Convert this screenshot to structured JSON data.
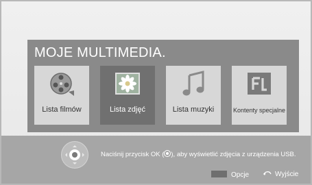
{
  "panel": {
    "title": "MOJE MULTIMEDIA."
  },
  "tiles": [
    {
      "label": "Lista filmów",
      "icon": "film-reel-icon",
      "selected": false
    },
    {
      "label": "Lista zdjęć",
      "icon": "photo-flower-icon",
      "selected": true
    },
    {
      "label": "Lista muzyki",
      "icon": "music-note-icon",
      "selected": false
    },
    {
      "label": "Kontenty specjalne",
      "icon": "fl-logo-icon",
      "selected": false
    }
  ],
  "hint": {
    "before": "Naciśnij przycisk OK (",
    "after": "), aby wyświetlić zdjęcia z urządzenia USB."
  },
  "footer": {
    "options_label": "Opcje",
    "exit_label": "Wyjście"
  },
  "colors": {
    "panel": "#8a8a8a",
    "tile": "#d7d7d7",
    "tile_selected": "#707070",
    "footer": "#a6a6a6"
  }
}
